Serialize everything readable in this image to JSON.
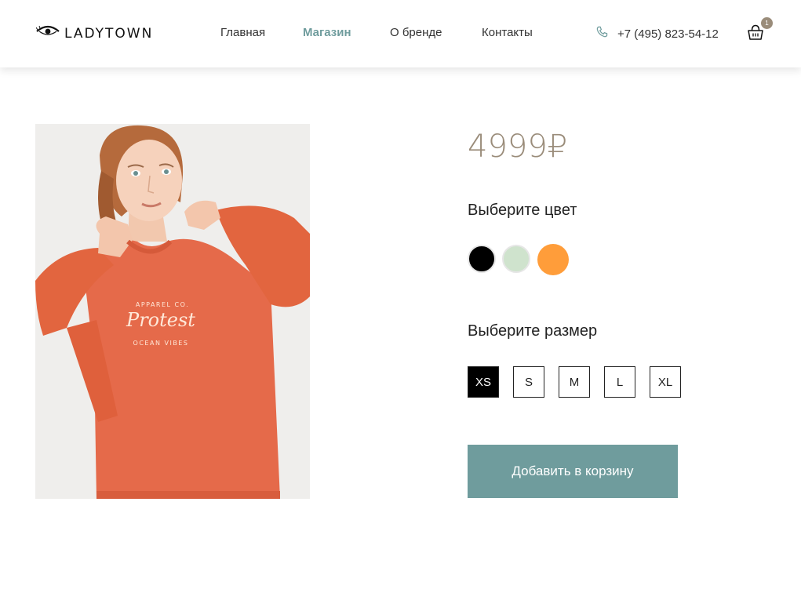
{
  "header": {
    "logo_text": "LADYTOWN",
    "nav": [
      {
        "label": "Главная",
        "active": false
      },
      {
        "label": "Магазин",
        "active": true
      },
      {
        "label": "О бренде",
        "active": false
      },
      {
        "label": "Контакты",
        "active": false
      }
    ],
    "phone": "+7 (495) 823-54-12",
    "cart_count": "1"
  },
  "product": {
    "price": "4999₽",
    "color_label": "Выберите цвет",
    "colors": [
      "#000000",
      "#cfe3cd",
      "#ff9d3a"
    ],
    "size_label": "Выберите размер",
    "sizes": [
      "XS",
      "S",
      "M",
      "L",
      "XL"
    ],
    "selected_size": "XS",
    "add_to_cart": "Добавить в корзину",
    "print_text": {
      "line1": "APPAREL CO.",
      "line2": "Protest",
      "line3": "OCEAN VIBES"
    }
  },
  "colors": {
    "accent": "#6f9c9d",
    "price": "#9a8c7a",
    "sweater": "#e56a4a"
  },
  "icons": {
    "logo": "eye-icon",
    "phone": "phone-icon",
    "cart": "basket-icon"
  }
}
